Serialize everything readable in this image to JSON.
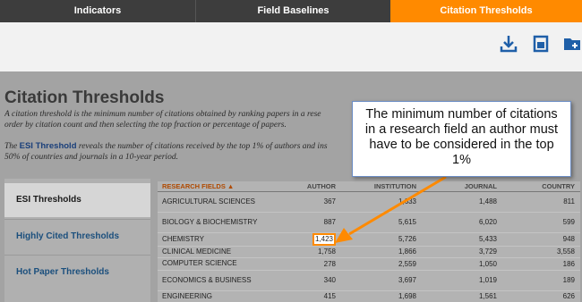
{
  "tabs": [
    {
      "label": "Indicators"
    },
    {
      "label": "Field Baselines"
    },
    {
      "label": "Citation Thresholds"
    }
  ],
  "toolbar": {
    "download_icon": "download-icon",
    "print_icon": "print-icon",
    "folder_icon": "add-to-folder-icon"
  },
  "page": {
    "title": "Citation Thresholds",
    "desc1_line1": "A citation threshold is the minimum number of citations obtained by ranking papers in a rese",
    "desc1_line2": "order by citation count and then selecting the top fraction or percentage of papers.",
    "desc2_pre": "The ",
    "desc2_link": "ESI Threshold",
    "desc2_post": " reveals the number of citations received by the top 1% of authors and ins",
    "desc2_line2": "50% of countries and journals in a 10-year period."
  },
  "sidebar": {
    "items": [
      {
        "label": "ESI Thresholds"
      },
      {
        "label": "Highly Cited Thresholds"
      },
      {
        "label": "Hot Paper Thresholds"
      }
    ]
  },
  "table": {
    "headers": {
      "field": "RESEARCH FIELDS ▲",
      "author": "AUTHOR",
      "institution": "INSTITUTION",
      "journal": "JOURNAL",
      "country": "COUNTRY"
    },
    "rows": [
      {
        "field": "AGRICULTURAL SCIENCES",
        "author": "367",
        "institution": "1,633",
        "journal": "1,488",
        "country": "811"
      },
      {
        "field": "BIOLOGY & BIOCHEMISTRY",
        "author": "887",
        "institution": "5,615",
        "journal": "6,020",
        "country": "599"
      },
      {
        "field": "CHEMISTRY",
        "author": "1,423",
        "institution": "5,726",
        "journal": "5,433",
        "country": "948"
      },
      {
        "field": "CLINICAL MEDICINE",
        "author": "1,758",
        "institution": "1,866",
        "journal": "3,729",
        "country": "3,558"
      },
      {
        "field": "COMPUTER SCIENCE",
        "author": "278",
        "institution": "2,559",
        "journal": "1,050",
        "country": "186"
      },
      {
        "field": "ECONOMICS & BUSINESS",
        "author": "340",
        "institution": "3,697",
        "journal": "1,019",
        "country": "189"
      },
      {
        "field": "ENGINEERING",
        "author": "415",
        "institution": "1,698",
        "journal": "1,561",
        "country": "626"
      }
    ]
  },
  "callout": {
    "text": "The minimum number of citations in a research field an author must have to be considered in the top 1%"
  },
  "colors": {
    "active_tab": "#ff8a00",
    "highlight_border": "#ff8a00",
    "link": "#1b4f7d"
  }
}
